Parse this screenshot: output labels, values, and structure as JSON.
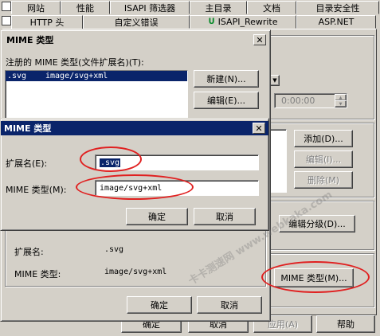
{
  "props": {
    "tabs_row1": [
      "网站",
      "性能",
      "ISAPI 筛选器",
      "主目录",
      "文档",
      "目录安全性"
    ],
    "tabs_row2": [
      "HTTP 头",
      "自定义错误",
      "ISAPI_Rewrite",
      "ASP.NET"
    ],
    "time_value": "0:00:00",
    "add_button": "添加(D)...",
    "edit_button": "编辑(I)...",
    "delete_button": "删除(M)",
    "edit_rating_button": "编辑分级(D)...",
    "mime_button": "MIME 类型(M)...",
    "ok_button": "确定",
    "cancel_button": "取消",
    "apply_button": "应用(A)",
    "help_button": "帮助"
  },
  "mime_list_dialog": {
    "title": "MIME 类型",
    "list_label": "注册的 MIME 类型(文件扩展名)(T):",
    "rows": [
      {
        "ext": ".svg",
        "type": "image/svg+xml"
      }
    ],
    "new_button": "新建(N)...",
    "edit_button": "编辑(E)...",
    "details_ext_label": "扩展名:",
    "details_ext_value": ".svg",
    "details_type_label": "MIME 类型:",
    "details_type_value": "image/svg+xml",
    "ok_button": "确定",
    "cancel_button": "取消"
  },
  "mime_edit_dialog": {
    "title": "MIME 类型",
    "ext_label": "扩展名(E):",
    "ext_value": ".svg",
    "type_label": "MIME 类型(M):",
    "type_value": "image/svg+xml",
    "ok_button": "确定",
    "cancel_button": "取消"
  },
  "watermark": "卡卡测速网 www.webkaka.com",
  "colors": {
    "active_title": "#0a246a",
    "annotation": "#e02020",
    "face": "#d4d0c8"
  }
}
